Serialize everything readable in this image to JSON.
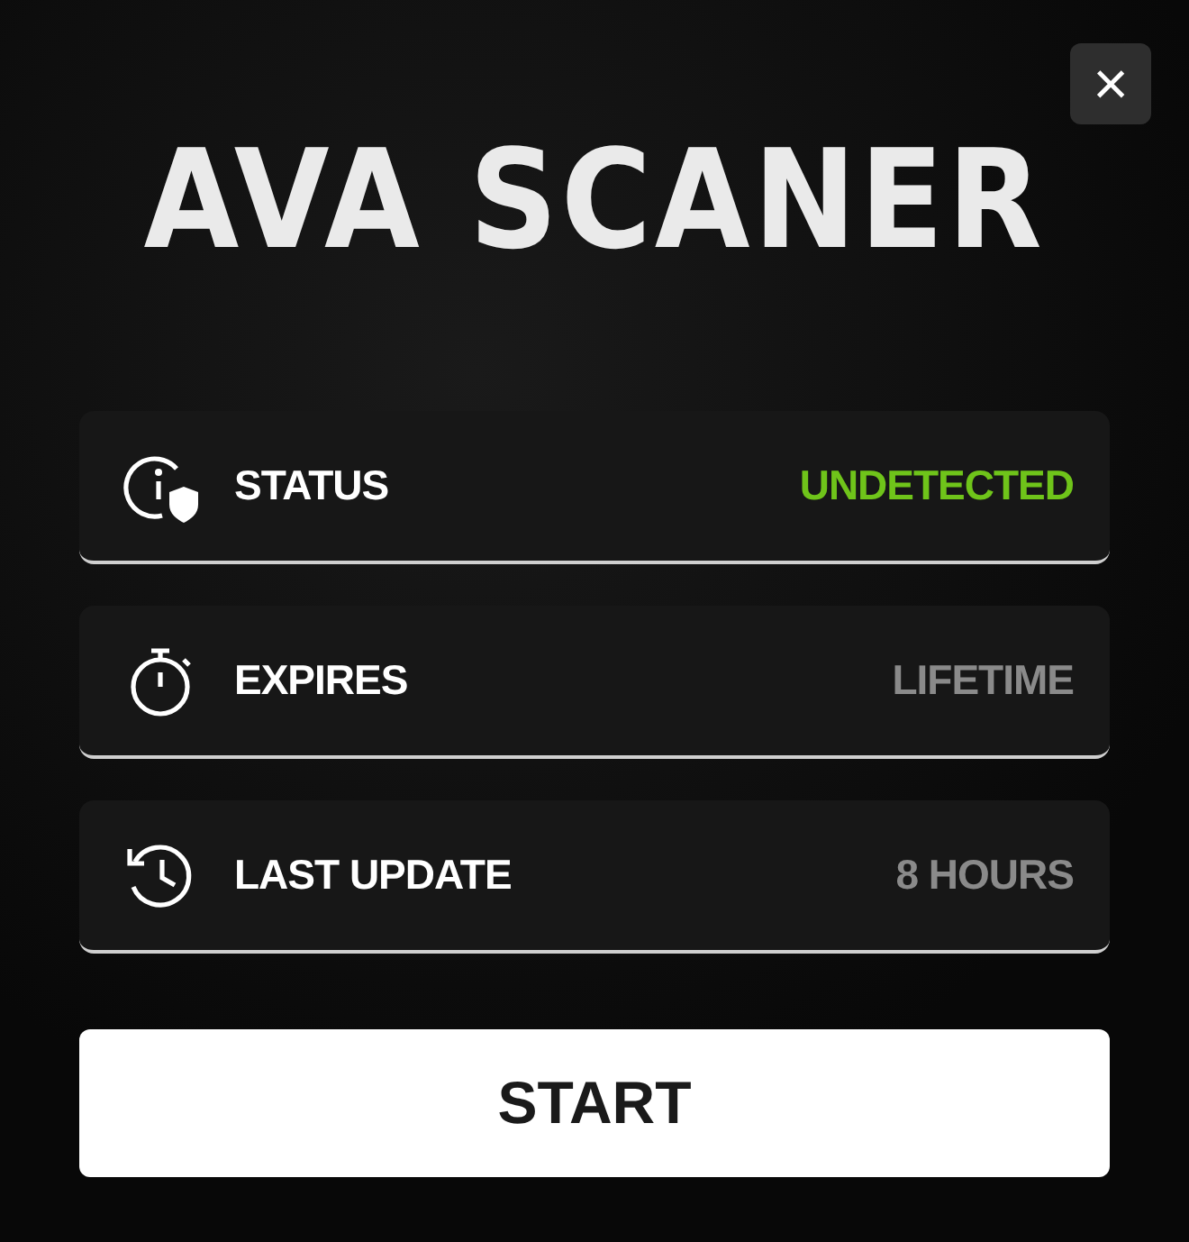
{
  "title": "AVA SCANER",
  "close_button": "×",
  "info_rows": [
    {
      "kind": "status",
      "label": "STATUS",
      "value": "UNDETECTED",
      "color": "#6fc41a"
    },
    {
      "kind": "timer",
      "label": "EXPIRES",
      "value": "LIFETIME",
      "color": "#8a8a8a"
    },
    {
      "kind": "history",
      "label": "LAST UPDATE",
      "value": "8 HOURS",
      "color": "#8a8a8a"
    }
  ],
  "start_button": "START"
}
